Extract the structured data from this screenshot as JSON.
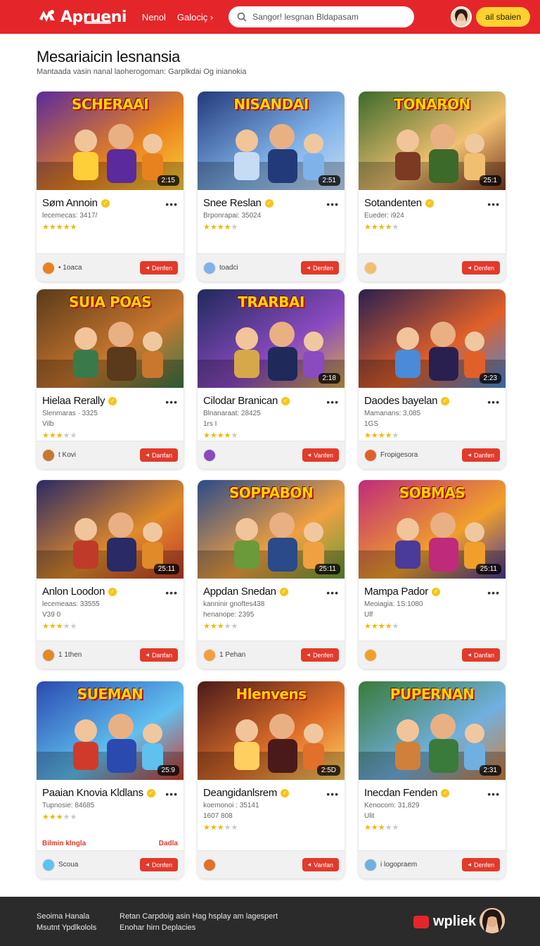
{
  "header": {
    "brand": "Aprueni",
    "nav": [
      "Nenol",
      "Galociç"
    ],
    "search_placeholder": "Sangor! lesgnan Bldapasam",
    "cta": "ail sbaien"
  },
  "page": {
    "title": "Mesariaicin lesnansia",
    "subtitle": "Mantaada vasin nanal laoherogoman: Garplkdai Og inianokia"
  },
  "cards": [
    {
      "thumb_title": "SCHERAAI",
      "duration": "2:15",
      "name": "Søm Annoin",
      "meta1": "lecemecas: 3417/",
      "meta2": "",
      "rating": 5,
      "foot_text": "• 1oaca",
      "button": "Denfen"
    },
    {
      "thumb_title": "NISANDAI",
      "duration": "2:51",
      "name": "Snee Reslan",
      "meta1": "Brponrapai: 35024",
      "meta2": "",
      "rating": 4,
      "foot_text": "toadci",
      "button": "Denfen"
    },
    {
      "thumb_title": "TONARON",
      "duration": "25:1",
      "name": "Sotandenten",
      "meta1": "Eueder: i924",
      "meta2": "",
      "rating": 4,
      "foot_text": "",
      "button": "Denfen"
    },
    {
      "thumb_title": "SUIA POAS",
      "duration": "",
      "name": "Hielaa Rerally",
      "meta1": "Slenmaras · 3325",
      "meta2": "Vilb",
      "rating": 3,
      "foot_text": "t Kovi",
      "button": "Danfan"
    },
    {
      "thumb_title": "TRARBAI",
      "duration": "2:18",
      "name": "Cilodar Branican",
      "meta1": "Blnanaraat: 28425",
      "meta2": "1rs   I",
      "rating": 4,
      "foot_text": "",
      "button": "Vanfen"
    },
    {
      "thumb_title": "",
      "duration": "2:23",
      "name": "Daodes bayelan",
      "meta1": "Mamanans: 3,085",
      "meta2": "1GS",
      "rating": 4,
      "foot_text": "Fropigesora",
      "button": "Danfen"
    },
    {
      "thumb_title": "",
      "duration": "25:11",
      "name": "Anlon Loodon",
      "meta1": "lecemeaas: 33555",
      "meta2": "V39   0",
      "rating": 3,
      "foot_text": "1 1then",
      "button": "Danfan"
    },
    {
      "thumb_title": "SOPPABON",
      "duration": "25:11",
      "name": "Appdan Snedan",
      "meta1": "kanninir gnoftes438",
      "meta2": "henanope: 2395",
      "rating": 3,
      "foot_text": "1 Pehan",
      "button": "Denfen"
    },
    {
      "thumb_title": "SOBMAS",
      "duration": "25:11",
      "name": "Mampa Pador",
      "meta1": "Meoiagia: 1S:1080",
      "meta2": "Ulf",
      "rating": 4,
      "foot_text": "",
      "button": "Danfan"
    },
    {
      "thumb_title": "SUEMAN",
      "duration": "25:9",
      "name": "Paaian Knovia Kldlans",
      "meta1": "Tupnosie: 84685",
      "meta2": "",
      "rating": 3,
      "foot_text": "Scoua",
      "button": "Donfen",
      "promo_left": "Bilmin klngla",
      "promo_right": "Dadla"
    },
    {
      "thumb_title": "Hlenvens",
      "duration": "2:5D",
      "name": "Deangidanlsrem",
      "meta1": "koemonoi : 35141",
      "meta2": "1607 808",
      "rating": 3,
      "foot_text": "",
      "button": "Vanfan"
    },
    {
      "thumb_title": "PUPERNAN",
      "duration": "2:31",
      "name": "Inecdan Fenden",
      "meta1": "Kenocom: 31,829",
      "meta2": "Ulit",
      "rating": 3,
      "foot_text": "i logopraem",
      "button": "Denfen"
    }
  ],
  "footer": {
    "col1": [
      "Seoima Hanala",
      "Msutnt Ypdlkolols"
    ],
    "col2": [
      "Retan Carpdoig asin  Hag hsplay am lagespert",
      "Enohar hirn Deplacies"
    ],
    "brand": "wpliek"
  },
  "colors": {
    "brand": "#e4262a",
    "accent": "#ffd231",
    "button": "#e23a2b",
    "star": "#f2b705"
  }
}
